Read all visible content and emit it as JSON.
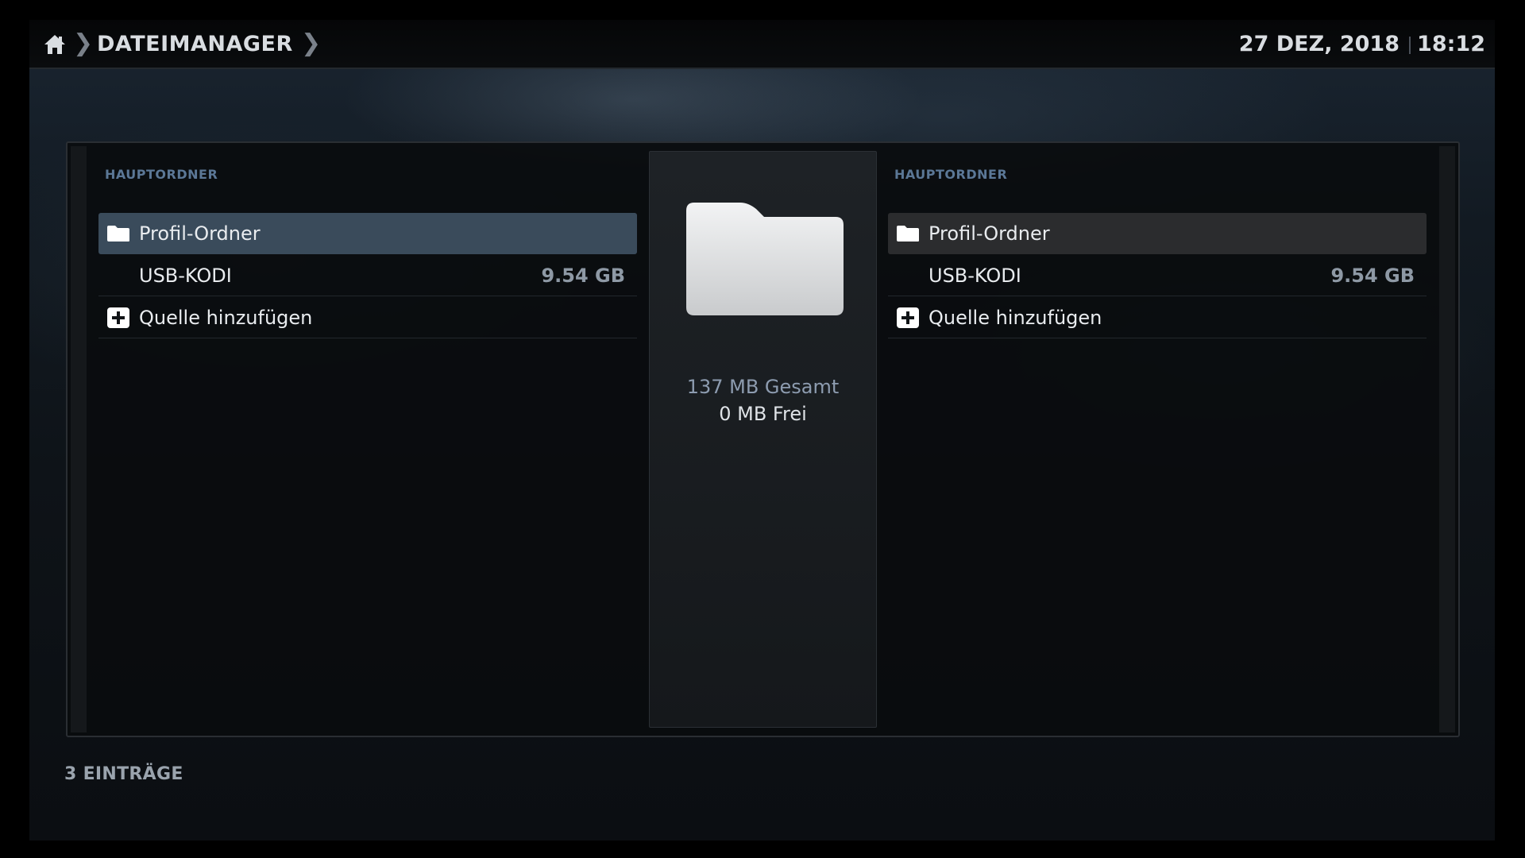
{
  "header": {
    "home_icon": "home-icon",
    "separator": "❯",
    "title": "DATEIMANAGER",
    "date": "27 DEZ, 2018",
    "time": "18:12"
  },
  "left_panel": {
    "heading": "HAUPTORDNER",
    "items": [
      {
        "label": "Profil-Ordner",
        "size": "",
        "icon": "folder-icon"
      },
      {
        "label": "USB-KODI",
        "size": "9.54 GB",
        "icon": ""
      },
      {
        "label": "Quelle hinzufügen",
        "size": "",
        "icon": "plus-box-icon"
      }
    ]
  },
  "right_panel": {
    "heading": "HAUPTORDNER",
    "items": [
      {
        "label": "Profil-Ordner",
        "size": "",
        "icon": "folder-icon"
      },
      {
        "label": "USB-KODI",
        "size": "9.54 GB",
        "icon": ""
      },
      {
        "label": "Quelle hinzufügen",
        "size": "",
        "icon": "plus-box-icon"
      }
    ]
  },
  "info": {
    "icon": "large-folder-icon",
    "total": "137 MB Gesamt",
    "free": "0 MB Frei"
  },
  "footer": {
    "count": "3 EINTRÄGE"
  },
  "colors": {
    "selected_left": "#3a4b5b",
    "selected_right": "#2b2c2e",
    "heading": "#5b7796",
    "text": "#e9ecef"
  }
}
